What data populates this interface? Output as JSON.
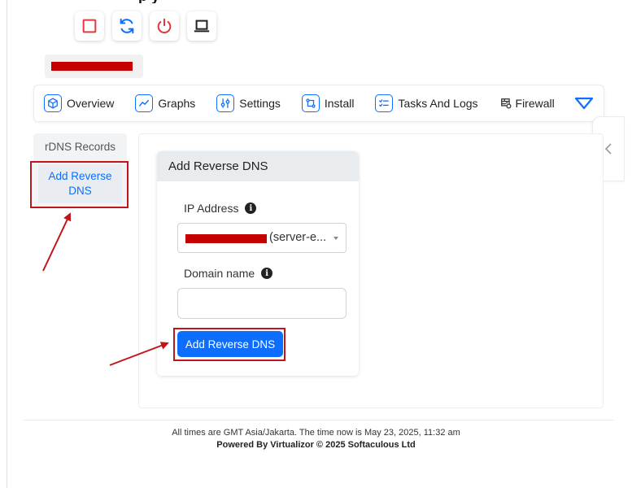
{
  "page": {
    "title_fragment": "p        y"
  },
  "power_buttons": [
    {
      "name": "stop-button",
      "icon": "stop-square-icon",
      "color": "#e0393e"
    },
    {
      "name": "restart-button",
      "icon": "refresh-icon",
      "color": "#0d6efd"
    },
    {
      "name": "poweroff-button",
      "icon": "power-icon",
      "color": "#e0393e"
    },
    {
      "name": "vnc-console-button",
      "icon": "laptop-icon",
      "color": "#222222"
    }
  ],
  "nav": {
    "items": [
      {
        "label": "Overview",
        "icon": "box-icon"
      },
      {
        "label": "Graphs",
        "icon": "chart-line-icon"
      },
      {
        "label": "Settings",
        "icon": "sliders-icon"
      },
      {
        "label": "Install",
        "icon": "git-compare-icon"
      },
      {
        "label": "Tasks And Logs",
        "icon": "checklist-icon"
      },
      {
        "label": "Firewall",
        "icon": "firewall-icon"
      }
    ],
    "more_icon": "chevron-down-icon"
  },
  "left_menu": {
    "header": "rDNS Records",
    "item": "Add Reverse DNS"
  },
  "card": {
    "header": "Add Reverse DNS",
    "ip_label": "IP Address",
    "ip_value_suffix": "(server-e...",
    "domain_label": "Domain name",
    "domain_value": "",
    "submit_label": "Add Reverse DNS"
  },
  "footer": {
    "line1": "All times are GMT Asia/Jakarta. The time now is May 23, 2025, 11:32 am",
    "line2": "Powered By Virtualizor © 2025 Softaculous Ltd"
  },
  "colors": {
    "accent": "#0d6efd",
    "annotation": "#c0151a",
    "danger": "#e0393e"
  }
}
